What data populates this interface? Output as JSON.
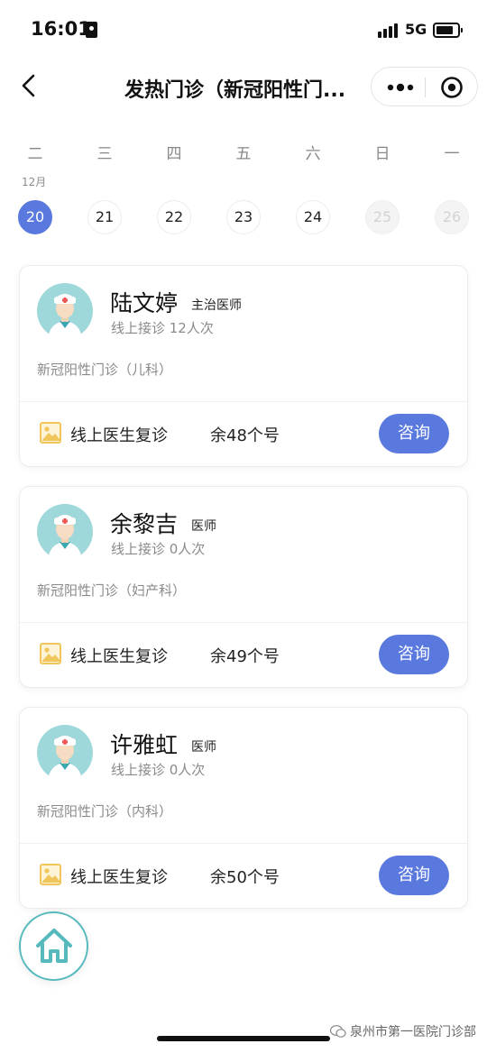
{
  "status_bar": {
    "time": "16:01",
    "network": "5G"
  },
  "nav": {
    "title": "发热门诊（新冠阳性门..."
  },
  "calendar": {
    "month_label": "12月",
    "weekdays": [
      "二",
      "三",
      "四",
      "五",
      "六",
      "日",
      "一"
    ],
    "dates": [
      {
        "day": "20",
        "state": "selected"
      },
      {
        "day": "21",
        "state": "available"
      },
      {
        "day": "22",
        "state": "available"
      },
      {
        "day": "23",
        "state": "available"
      },
      {
        "day": "24",
        "state": "available"
      },
      {
        "day": "25",
        "state": "disabled"
      },
      {
        "day": "26",
        "state": "disabled"
      }
    ]
  },
  "doctors": [
    {
      "name": "陆文婷",
      "title": "主治医师",
      "stats": "线上接诊 12人次",
      "department": "新冠阳性门诊（儿科）",
      "service": "线上医生复诊",
      "remaining": "余48个号",
      "button": "咨询"
    },
    {
      "name": "余黎吉",
      "title": "医师",
      "stats": "线上接诊 0人次",
      "department": "新冠阳性门诊（妇产科）",
      "service": "线上医生复诊",
      "remaining": "余49个号",
      "button": "咨询"
    },
    {
      "name": "许雅虹",
      "title": "医师",
      "stats": "线上接诊 0人次",
      "department": "新冠阳性门诊（内科）",
      "service": "线上医生复诊",
      "remaining": "余50个号",
      "button": "咨询"
    }
  ],
  "watermark": "泉州市第一医院门诊部",
  "colors": {
    "accent": "#5a79df",
    "home_ring": "#56b9bd",
    "service_icon": "#f0c65a"
  }
}
